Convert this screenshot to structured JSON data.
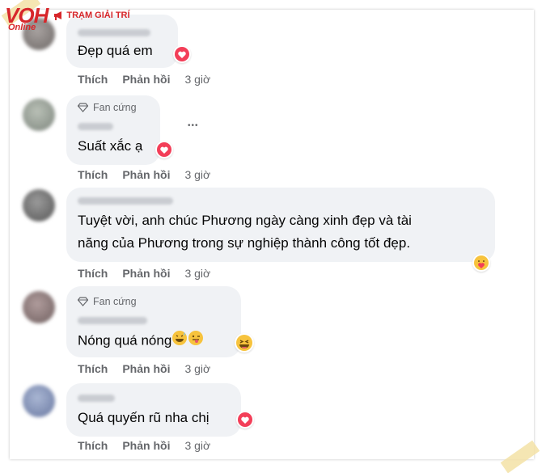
{
  "logo": {
    "brand": "VOH",
    "sub": "Online",
    "channel": "TRẠM GIẢI TRÍ"
  },
  "comments": [
    {
      "text": "Đẹp quá em",
      "actions": {
        "like": "Thích",
        "reply": "Phản hồi",
        "time": "3 giờ"
      },
      "reaction": "heart-icon"
    },
    {
      "badge": "Fan cứng",
      "text": "Suất xắc ạ",
      "actions": {
        "like": "Thích",
        "reply": "Phản hồi",
        "time": "3 giờ"
      },
      "reaction": "heart-icon",
      "more": "•••"
    },
    {
      "text_line1": "Tuyệt vời, anh chúc Phương ngày càng xinh đẹp và tài",
      "text_line2": "năng của Phương trong sự nghiệp thành công tốt đẹp.",
      "actions": {
        "like": "Thích",
        "reply": "Phản hồi",
        "time": "3 giờ"
      },
      "reaction": "care-icon"
    },
    {
      "badge": "Fan cứng",
      "text": "Nóng quá nóng",
      "actions": {
        "like": "Thích",
        "reply": "Phản hồi",
        "time": "3 giờ"
      },
      "reaction": "haha-icon"
    },
    {
      "text": "Quá quyến rũ nha chị",
      "actions": {
        "like": "Thích",
        "reply": "Phản hồi",
        "time": "3 giờ"
      },
      "reaction": "heart-icon"
    }
  ]
}
